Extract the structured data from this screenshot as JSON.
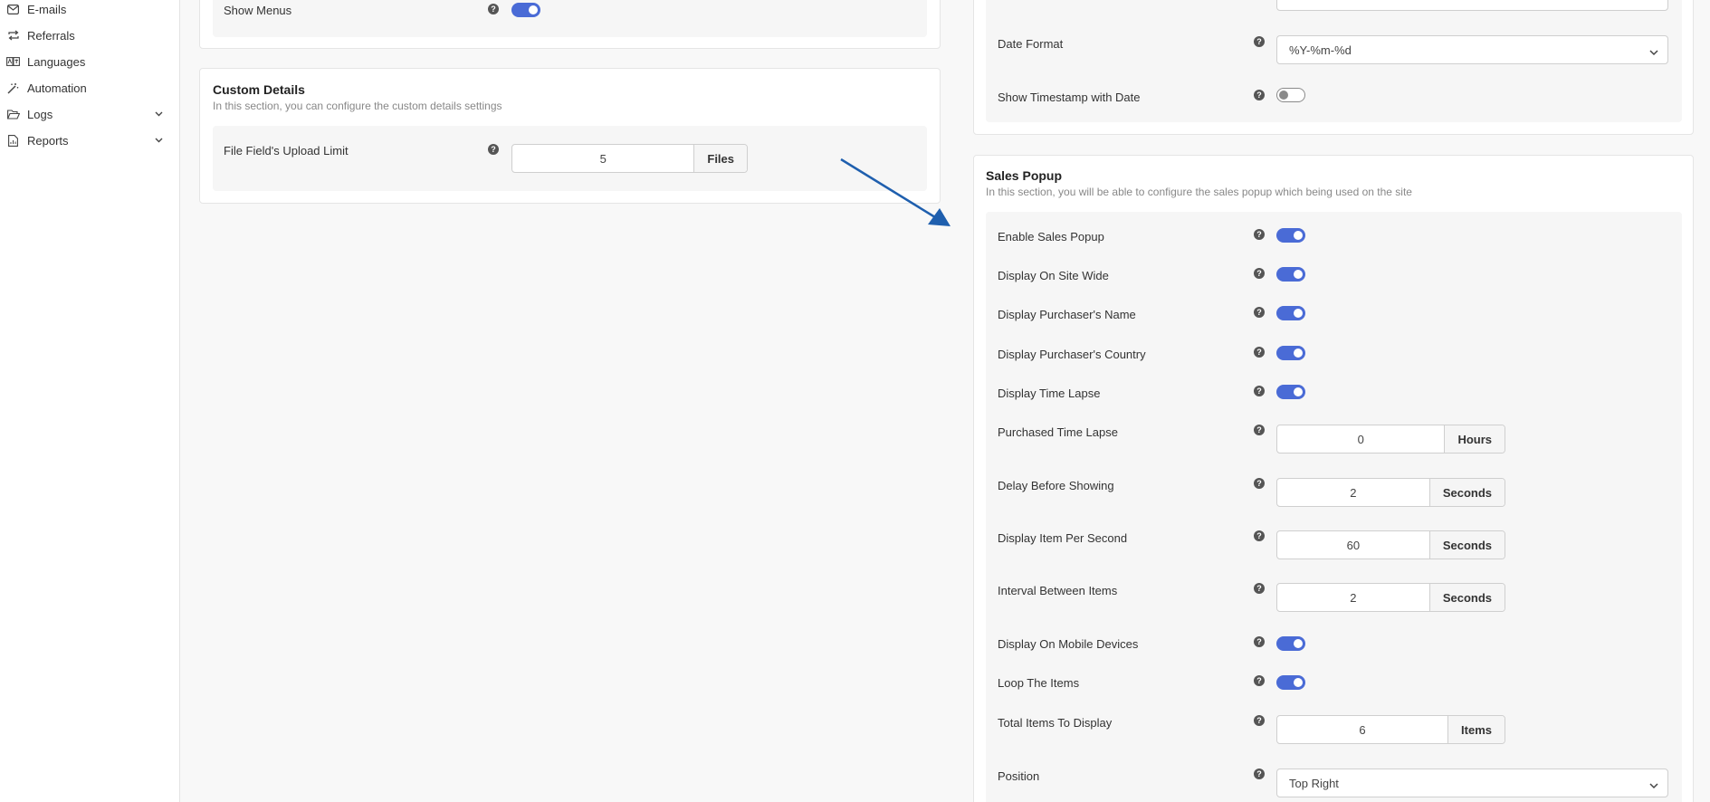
{
  "sidebar": {
    "items": [
      {
        "label": "E-mails",
        "icon": "mail-icon"
      },
      {
        "label": "Referrals",
        "icon": "repeat-icon"
      },
      {
        "label": "Languages",
        "icon": "language-icon"
      },
      {
        "label": "Automation",
        "icon": "magic-wand-icon"
      },
      {
        "label": "Logs",
        "icon": "folder-open-icon"
      },
      {
        "label": "Reports",
        "icon": "file-report-icon"
      }
    ]
  },
  "left": {
    "show_menus_label": "Show Menus",
    "show_menus_on": true,
    "custom_details": {
      "title": "Custom Details",
      "description": "In this section, you can configure the custom details settings",
      "upload_limit_label": "File Field's Upload Limit",
      "upload_limit_value": "5",
      "upload_limit_unit": "Files"
    }
  },
  "right": {
    "date_format_label": "Date Format",
    "date_format_value": "%Y-%m-%d",
    "show_timestamp_label": "Show Timestamp with Date",
    "show_timestamp_on": false,
    "sales_popup": {
      "title": "Sales Popup",
      "description": "In this section, you will be able to configure the sales popup which being used on the site",
      "enable_label": "Enable Sales Popup",
      "site_wide_label": "Display On Site Wide",
      "purchaser_name_label": "Display Purchaser's Name",
      "purchaser_country_label": "Display Purchaser's Country",
      "time_lapse_label": "Display Time Lapse",
      "purchased_time_lapse_label": "Purchased Time Lapse",
      "purchased_time_lapse_value": "0",
      "purchased_time_lapse_unit": "Hours",
      "delay_label": "Delay Before Showing",
      "delay_value": "2",
      "delay_unit": "Seconds",
      "item_per_second_label": "Display Item Per Second",
      "item_per_second_value": "60",
      "item_per_second_unit": "Seconds",
      "interval_label": "Interval Between Items",
      "interval_value": "2",
      "interval_unit": "Seconds",
      "mobile_label": "Display On Mobile Devices",
      "loop_label": "Loop The Items",
      "total_items_label": "Total Items To Display",
      "total_items_value": "6",
      "total_items_unit": "Items",
      "position_label": "Position",
      "position_value": "Top Right"
    }
  },
  "colors": {
    "accent": "#4a6bd6",
    "arrow": "#1f5fae"
  }
}
